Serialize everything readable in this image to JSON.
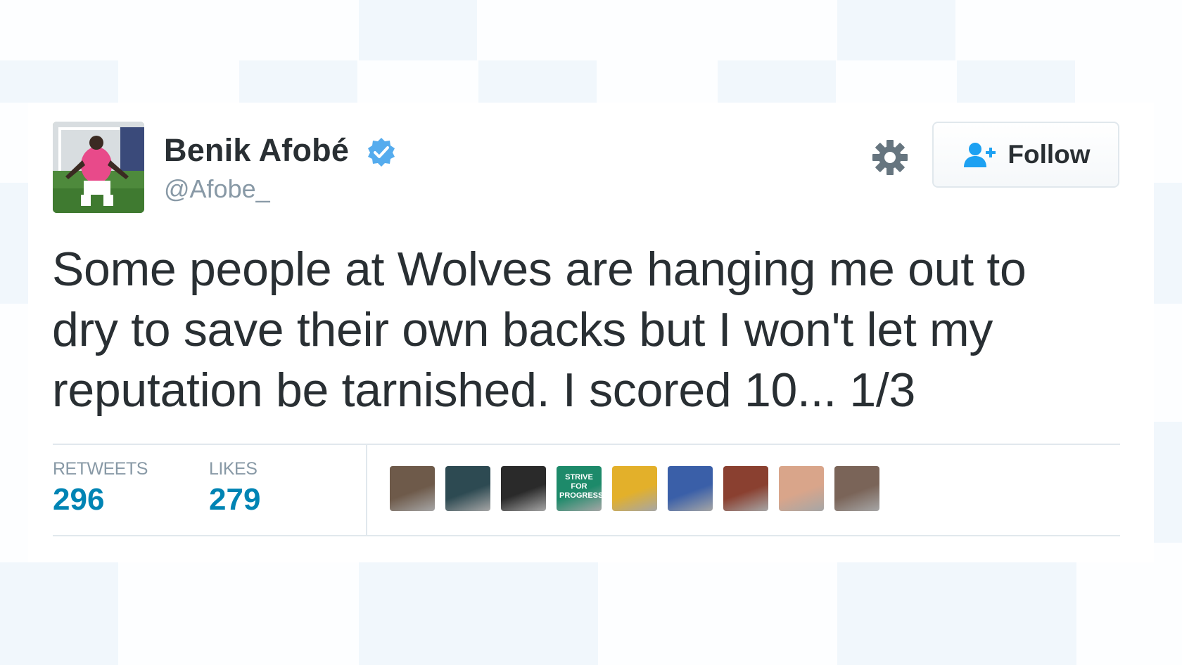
{
  "user": {
    "display_name": "Benik Afobé",
    "handle": "@Afobe_",
    "verified": true,
    "avatar_icon": "footballer-avatar"
  },
  "follow_button": {
    "label": "Follow",
    "icon": "add-user-icon"
  },
  "settings_icon": "gear-icon",
  "tweet": {
    "text": "Some people at Wolves are hanging me out to dry to save their own backs but I won't let my reputation be tarnished. I scored 10... 1/3"
  },
  "stats": {
    "retweets_label": "RETWEETS",
    "retweets_value": "296",
    "likes_label": "LIKES",
    "likes_value": "279"
  },
  "likers": [
    {
      "name": "liker-avatar-1",
      "color": "#6e5a4a"
    },
    {
      "name": "liker-avatar-2",
      "color": "#2d4a52"
    },
    {
      "name": "liker-avatar-3",
      "color": "#2a2a2a"
    },
    {
      "name": "liker-avatar-4",
      "color": "#1d8a6a",
      "text": "STRIVE FOR PROGRESS"
    },
    {
      "name": "liker-avatar-5",
      "color": "#e3b02a"
    },
    {
      "name": "liker-avatar-6",
      "color": "#3a5fa8"
    },
    {
      "name": "liker-avatar-7",
      "color": "#8a4030"
    },
    {
      "name": "liker-avatar-8",
      "color": "#d9a58a"
    },
    {
      "name": "liker-avatar-9",
      "color": "#7a6458"
    }
  ],
  "colors": {
    "link_blue": "#0084b4",
    "verified_blue": "#55acee",
    "text": "#292f33",
    "muted": "#8899a6",
    "border": "#e1e8ed"
  }
}
